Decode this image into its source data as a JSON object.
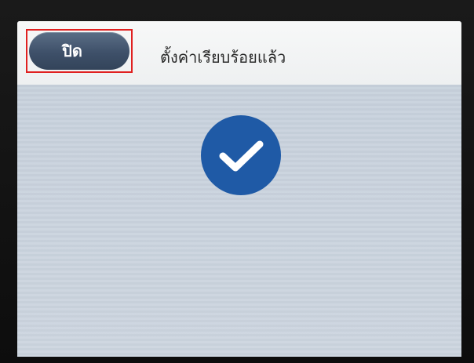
{
  "dialog": {
    "close_label": "ปิด",
    "title": "ตั้งค่าเรียบร้อยแล้ว",
    "status_icon": "check-circle",
    "accent_color": "#1f5aa6",
    "highlight_color": "#e02020"
  }
}
